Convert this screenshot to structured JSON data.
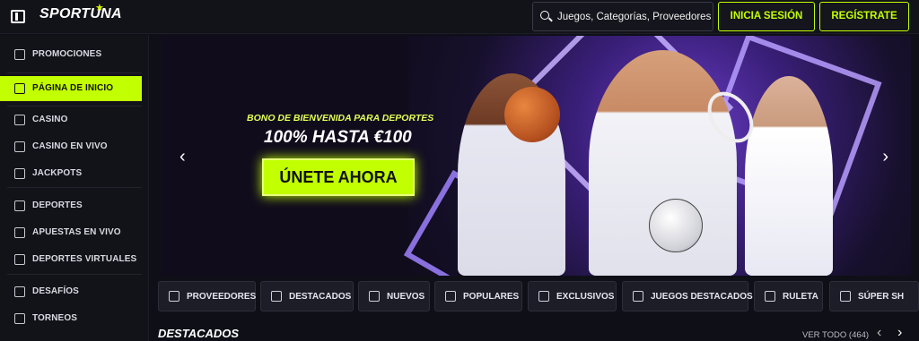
{
  "brand": {
    "name": "SPORTUNA"
  },
  "header": {
    "search_placeholder": "Juegos, Categorías, Proveedores",
    "login_label": "INICIA SESIÓN",
    "register_label": "REGÍSTRATE"
  },
  "sidebar": {
    "items": [
      {
        "label": "PROMOCIONES",
        "icon": "gift-icon"
      },
      {
        "label": "PÁGINA DE INICIO",
        "icon": "home-icon",
        "active": true
      },
      {
        "label": "CASINO",
        "icon": "cards-icon"
      },
      {
        "label": "CASINO EN VIVO",
        "icon": "live-casino-icon"
      },
      {
        "label": "JACKPOTS",
        "icon": "seven-icon"
      },
      {
        "label": "DEPORTES",
        "icon": "soccer-icon"
      },
      {
        "label": "APUESTAS EN VIVO",
        "icon": "video-icon"
      },
      {
        "label": "DEPORTES VIRTUALES",
        "icon": "gamepad-icon"
      },
      {
        "label": "DESAFÍOS",
        "icon": "medal-icon"
      },
      {
        "label": "TORNEOS",
        "icon": "trophy-icon"
      }
    ]
  },
  "banner": {
    "kicker": "BONO DE BIENVENIDA PARA DEPORTES",
    "headline": "100% HASTA €100",
    "cta": "ÚNETE AHORA",
    "colors": {
      "accent": "#c2ff00",
      "purple": "#6b3ec8"
    }
  },
  "categories": [
    {
      "label": "PROVEEDORES",
      "icon": "layers-icon"
    },
    {
      "label": "DESTACADOS",
      "icon": "crown-icon"
    },
    {
      "label": "NUEVOS",
      "icon": "lightning-icon"
    },
    {
      "label": "POPULARES",
      "icon": "flame-icon"
    },
    {
      "label": "EXCLUSIVOS",
      "icon": "diamond-icon"
    },
    {
      "label": "JUEGOS DESTACADOS",
      "icon": "card-icon"
    },
    {
      "label": "RULETA",
      "icon": "roulette-icon"
    },
    {
      "label": "SÚPER SH",
      "icon": "mic-icon"
    }
  ],
  "featured": {
    "title": "DESTACADOS",
    "view_all": "VER TODO (464)"
  }
}
